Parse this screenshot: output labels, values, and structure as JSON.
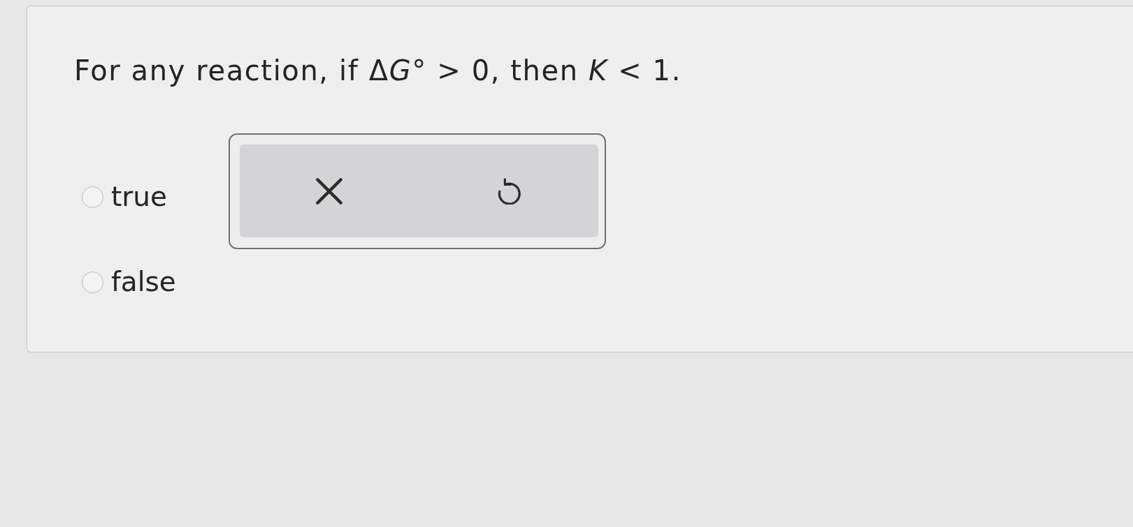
{
  "question": {
    "segments": [
      {
        "text": "For any reaction, if Δ",
        "italic": false
      },
      {
        "text": "G",
        "italic": true
      },
      {
        "text": "° > 0, then ",
        "italic": false
      },
      {
        "text": "K",
        "italic": true
      },
      {
        "text": " < 1.",
        "italic": false
      }
    ]
  },
  "options": [
    {
      "label": "true",
      "selected": false
    },
    {
      "label": "false",
      "selected": false
    }
  ],
  "answer_tools": [
    {
      "kind": "clear"
    },
    {
      "kind": "reset"
    }
  ]
}
